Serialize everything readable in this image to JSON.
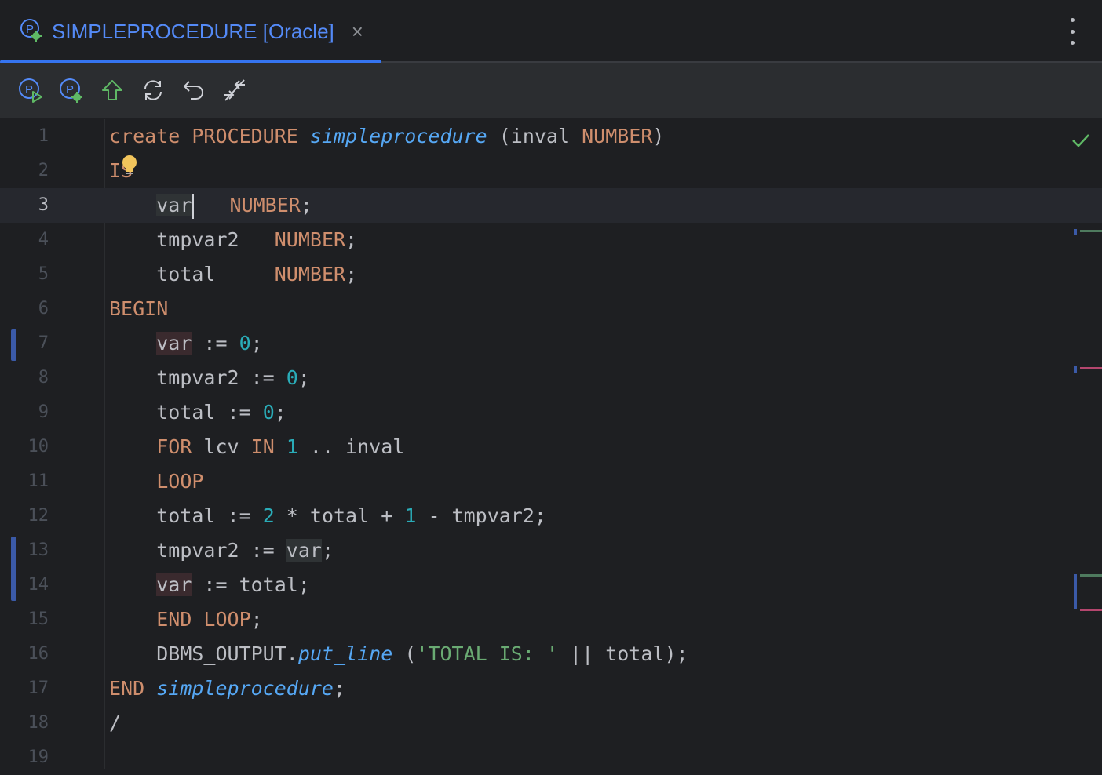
{
  "tab": {
    "title": "SIMPLEPROCEDURE [Oracle]",
    "close": "×"
  },
  "toolbar": {
    "buttons": [
      "run-procedure",
      "debug-procedure",
      "submit",
      "refresh",
      "revert",
      "compare"
    ]
  },
  "colors": {
    "accent": "#3574f0",
    "keyword": "#cf8e6d",
    "function": "#56a8f5",
    "number": "#2aacb8",
    "string": "#6aab73",
    "text": "#bcbec4",
    "background": "#1e1f22"
  },
  "editor": {
    "line_numbers": [
      "1",
      "2",
      "3",
      "4",
      "5",
      "6",
      "7",
      "8",
      "9",
      "10",
      "11",
      "12",
      "13",
      "14",
      "15",
      "16",
      "17",
      "18",
      "19"
    ],
    "current_line": 3,
    "lines": {
      "l1": {
        "kw1": "create PROCEDURE",
        "fn": "simpleprocedure",
        "p1": " (inval ",
        "kw2": "NUMBER",
        "p2": ")"
      },
      "l2": {
        "kw": "IS"
      },
      "l3": {
        "var": "var",
        "kw": "NUMBER",
        "p": ";"
      },
      "l4": {
        "name": "tmpvar2",
        "kw": "NUMBER",
        "p": ";"
      },
      "l5": {
        "name": "total",
        "kw": "NUMBER",
        "p": ";"
      },
      "l6": {
        "kw": "BEGIN"
      },
      "l7": {
        "var": "var",
        "op": " := ",
        "num": "0",
        "p": ";"
      },
      "l8": {
        "name": "tmpvar2",
        "op": " := ",
        "num": "0",
        "p": ";"
      },
      "l9": {
        "name": "total",
        "op": " := ",
        "num": "0",
        "p": ";"
      },
      "l10": {
        "kw1": "FOR",
        "p1": " lcv ",
        "kw2": "IN",
        "num": "1",
        "p2": " .. inval"
      },
      "l11": {
        "kw": "LOOP"
      },
      "l12": {
        "p1": "total := ",
        "num1": "2",
        "p2": " * total + ",
        "num2": "1",
        "p3": " - tmpvar2;"
      },
      "l13": {
        "p1": "tmpvar2 := ",
        "var": "var",
        "p2": ";"
      },
      "l14": {
        "var": "var",
        "p": " := total;"
      },
      "l15": {
        "kw": "END LOOP",
        "p": ";"
      },
      "l16": {
        "p1": "DBMS_OUTPUT.",
        "fn": "put_line",
        "p2": " (",
        "str": "'TOTAL IS: '",
        "p3": " || total);"
      },
      "l17": {
        "kw": "END",
        "fn": "simpleprocedure",
        "p": ";"
      },
      "l18": {
        "p": "/"
      }
    }
  }
}
